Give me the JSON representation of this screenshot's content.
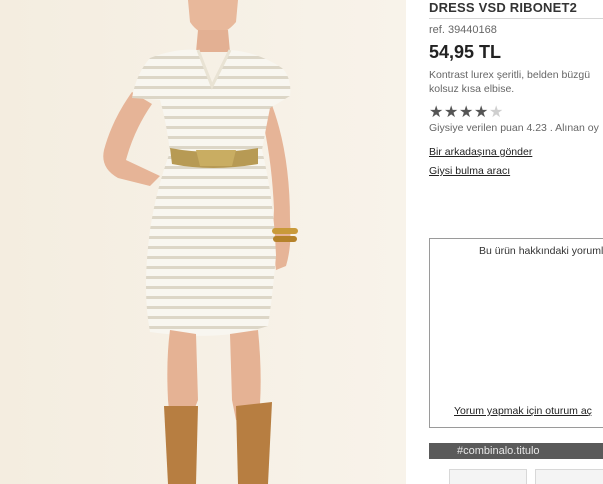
{
  "product": {
    "title": "DRESS VSD RIBONET2",
    "ref": "ref. 39440168",
    "price": "54,95 TL",
    "description_lines": [
      "Kontrast lurex şeritli, belden büzgü",
      "kolsuz kısa elbise."
    ],
    "rating_value": 4,
    "rating_max": 5,
    "rating_text": "Giysiye verilen puan 4.23 . Alınan oy"
  },
  "links": {
    "send_friend": "Bir arkadaşına gönder",
    "clothing_finder": "Giysi bulma aracı"
  },
  "comments": {
    "title": "Bu ürün hakkındaki yorumla",
    "login_link": "Yorum yapmak için oturum aç"
  },
  "combination": {
    "title": "#combinalo.titulo"
  },
  "icons": {
    "star": "star-icon"
  },
  "colors": {
    "combo_bar": "#5a5a5a",
    "star_on": "#555555",
    "star_off": "#cfcfcf"
  }
}
